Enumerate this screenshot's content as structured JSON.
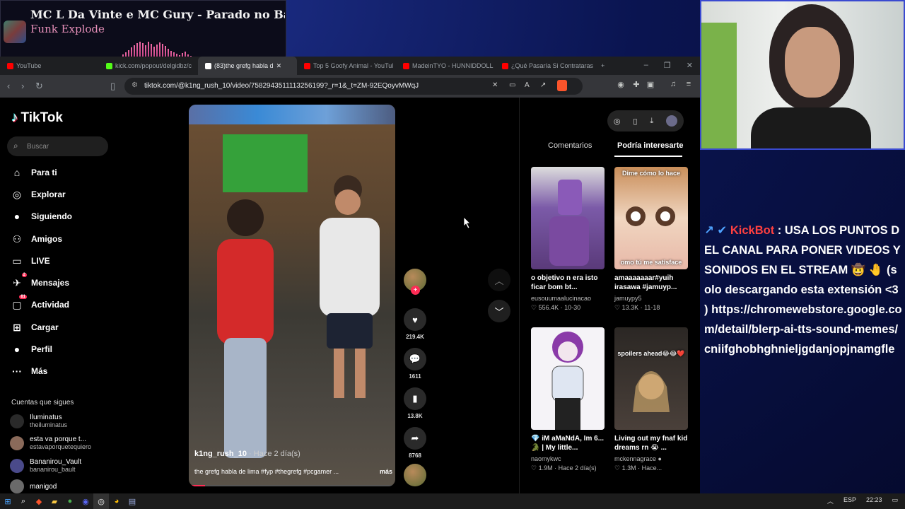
{
  "now_playing": {
    "title": "MC L Da Vinte e MC Gury - Parado no Bailão (F...",
    "artist": "Funk Explode"
  },
  "browser": {
    "tabs": [
      {
        "label": "YouTube",
        "color": "#ff0000"
      },
      {
        "label": "kick.com/popout/delgidbz/c",
        "color": "#53fc18"
      },
      {
        "label": "(83)the grefg habla d",
        "color": "#ffffff",
        "active": true
      },
      {
        "label": "Top 5 Goofy Animal - YouTul",
        "color": "#ff0000"
      },
      {
        "label": "MadeinTYO - HUNNIDDOLL",
        "color": "#ff0000"
      },
      {
        "label": "¿Qué Pasaría Si Contrataras",
        "color": "#ff0000"
      }
    ],
    "url": "tiktok.com/@k1ng_rush_10/video/7582943511113256199?_r=1&_t=ZM-92EQoyvMWqJ"
  },
  "tiktok": {
    "logo": "TikTok",
    "search_placeholder": "Buscar",
    "nav": [
      {
        "label": "Para ti",
        "icon": "home-icon",
        "glyph": "⌂"
      },
      {
        "label": "Explorar",
        "icon": "compass-icon",
        "glyph": "◎"
      },
      {
        "label": "Siguiendo",
        "icon": "following-avatar-icon",
        "glyph": "●"
      },
      {
        "label": "Amigos",
        "icon": "friends-icon",
        "glyph": "⚇"
      },
      {
        "label": "LIVE",
        "icon": "live-icon",
        "glyph": "▭"
      },
      {
        "label": "Mensajes",
        "icon": "messages-icon",
        "glyph": "✈",
        "badge": "2"
      },
      {
        "label": "Actividad",
        "icon": "activity-icon",
        "glyph": "▢",
        "badge": "81"
      },
      {
        "label": "Cargar",
        "icon": "upload-icon",
        "glyph": "⊞"
      },
      {
        "label": "Perfil",
        "icon": "profile-icon",
        "glyph": "●"
      },
      {
        "label": "Más",
        "icon": "more-icon",
        "glyph": "···"
      }
    ],
    "following_title": "Cuentas que sigues",
    "accounts": [
      {
        "name": "Iluminatus",
        "handle": "theiluminatus"
      },
      {
        "name": "esta va porque t...",
        "handle": "estavaporquetequiero"
      },
      {
        "name": "Bananirou_Vault",
        "handle": "bananirou_bault"
      },
      {
        "name": "manigod",
        "handle": ""
      }
    ],
    "video": {
      "username": "k1ng_rush_10",
      "time_ago": "· Hace 2 día(s)",
      "caption": "the grefg habla de lima #fyp #thegrefg #pcgamer ...",
      "more_label": "más",
      "progress_fraction": 0.08
    },
    "actions": {
      "likes": "219.4K",
      "comments": "1611",
      "saves": "13.8K",
      "shares": "8768"
    },
    "right_tabs": {
      "comments": "Comentarios",
      "suggested": "Podría interesarte"
    },
    "cards": [
      {
        "title": "o objetivo n era isto ficar bom bt...",
        "user": "eusouumaalucinacao",
        "meta": "♡ 556.4K · 10-30",
        "overlay": "",
        "bg": "#6b5b9a"
      },
      {
        "title": "amaaaaaaar#yuih irasawa #jamuyp...",
        "user": "jamuypy5",
        "meta": "♡ 13.3K · 11-18",
        "overlay": "Dime cómo lo hace",
        "overlay2": "omo tú me satisface",
        "bg": "#e8c9a8"
      },
      {
        "title": "💎 iM aMaNdA, Im 6... 🐊 | My little...",
        "user": "naomykwc",
        "meta": "♡ 1.9M · Hace 2 día(s)",
        "overlay": "",
        "bg": "#f3f0f5"
      },
      {
        "title": "Living out my fnaf kid dreams rn 😭 ...",
        "user": "mckennagrace ●",
        "meta": "♡ 1.3M · Hace...",
        "overlay": "spoilers ahead😂😂❤️",
        "bg": "#3a3530"
      }
    ]
  },
  "chat": {
    "badges": "↗ ✔",
    "user": "KickBot",
    "message": ": USA LOS PUNTOS DEL CANAL PARA PONER VIDEOS Y SONIDOS EN EL STREAM 🤠 🤚 (solo descargando esta extensión <3 ) https://chromewebstore.google.com/detail/blerp-ai-tts-sound-memes/cniifghobhghnieljgdanjopjnamgfle"
  },
  "taskbar": {
    "lang": "ESP",
    "time": "22:23"
  },
  "colors": {
    "accent": "#fe2c55",
    "chat_user": "#ff4040"
  }
}
